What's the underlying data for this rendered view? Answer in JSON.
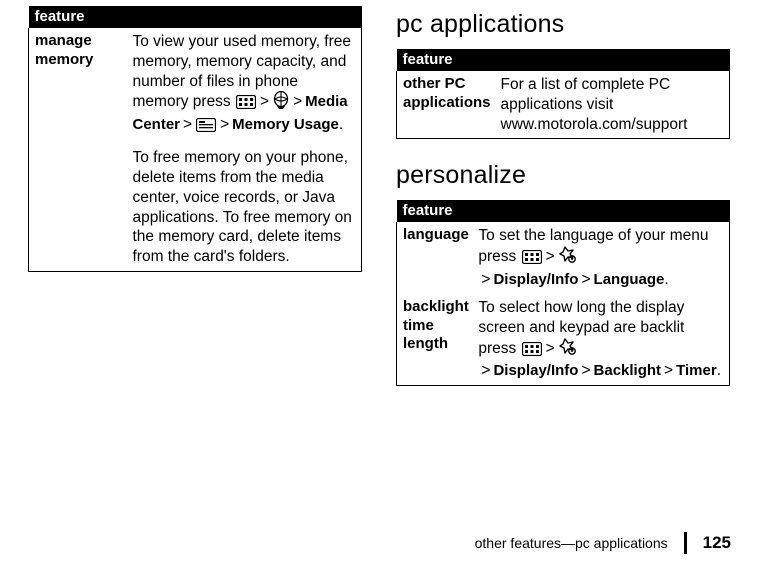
{
  "left": {
    "header": "feature",
    "row": {
      "name": "manage memory",
      "desc_part_a": "To view your used memory, free memory, memory capacity, and number of files in phone memory press ",
      "path1_a": "Media Center",
      "path1_b": "Memory Usage",
      "desc_para2": "To free memory on your phone, delete items from the media center, voice records, or Java applications. To free memory on the memory card, delete items from the card's folders."
    }
  },
  "right": {
    "section1_title": "pc applications",
    "table1_header": "feature",
    "table1_row": {
      "name": "other PC applications",
      "desc": "For a list of complete PC applications visit www.motorola.com/support"
    },
    "section2_title": "personalize",
    "table2_header": "feature",
    "table2_rows": [
      {
        "name": "language",
        "desc_a": "To set the language of your menu press ",
        "path_a": "Display/Info",
        "path_b": "Language"
      },
      {
        "name": "backlight time length",
        "desc_a": "To select how long the display screen and keypad are backlit press ",
        "path_a": "Display/Info",
        "path_b": "Backlight",
        "path_c": "Timer"
      }
    ]
  },
  "footer": {
    "text": "other features—pc applications",
    "page": "125"
  }
}
